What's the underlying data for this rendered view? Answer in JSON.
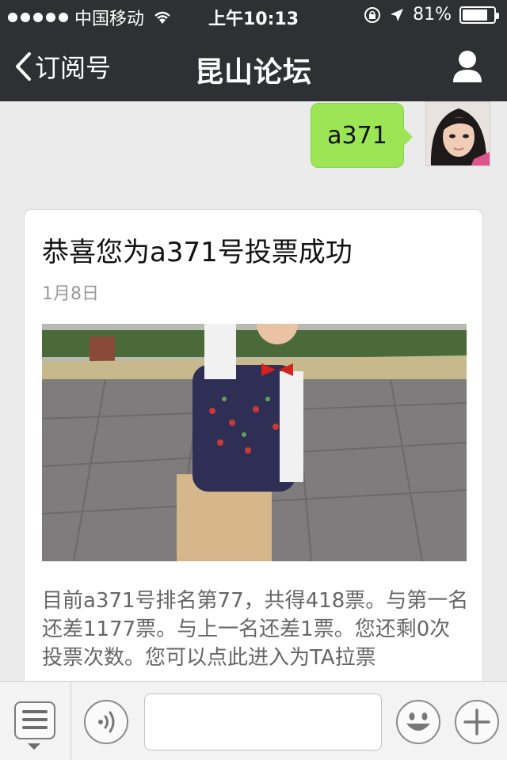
{
  "status_bar": {
    "carrier": "中国移动",
    "time": "上午10:13",
    "battery": "81%",
    "battery_level": 0.81
  },
  "nav": {
    "back_label": "订阅号",
    "title": "昆山论坛"
  },
  "chat": {
    "outgoing_message": "a371",
    "article": {
      "title": "恭喜您为a371号投票成功",
      "date": "1月8日",
      "body": "目前a371号排名第77，共得418票。与第一名还差1177票。与上一名还差1票。您还剩0次投票次数。您可以点此进入为TA拉票"
    }
  },
  "input_bar": {
    "message_value": ""
  },
  "colors": {
    "header_bg": "#2f3033",
    "chat_bg": "#ebebeb",
    "bubble_out": "#9ce554"
  },
  "icons": [
    "wifi-icon",
    "lock-rotation-icon",
    "location-arrow-icon",
    "battery-icon",
    "back-chevron-icon",
    "profile-icon",
    "menu-list-icon",
    "voice-icon",
    "emoji-icon",
    "plus-icon"
  ]
}
